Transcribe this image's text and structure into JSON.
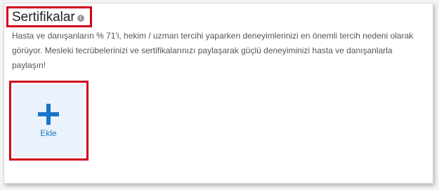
{
  "section": {
    "title": "Sertifikalar",
    "info_icon": "info-icon",
    "description": "Hasta ve danışanların % 71'i, hekim / uzman tercihi yaparken deneyimlerinizi en önemli tercih nedeni olarak görüyor. Mesleki tecrübelerinizi ve sertifikalarınızı paylaşarak güçlü deneyiminizi hasta ve danışanlarla paylaşın!"
  },
  "add_card": {
    "icon": "plus-icon",
    "label": "Ekle"
  },
  "colors": {
    "accent": "#1a73c9",
    "highlight": "#d0021b",
    "card_background": "#eaf3fb"
  }
}
